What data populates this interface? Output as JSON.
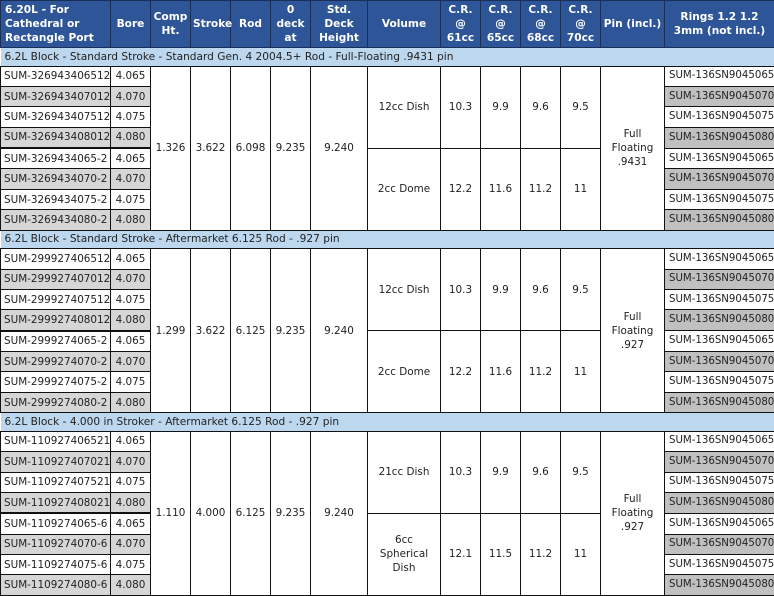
{
  "header": {
    "part": "6.20L - For Cathedral or Rectangle Port",
    "bore": "Bore",
    "comp_ht": "Comp Ht.",
    "stroke": "Stroke",
    "rod": "Rod",
    "deck0": "0 deck at",
    "std_deck": "Std. Deck Height",
    "volume": "Volume",
    "cr61": "C.R. @ 61cc",
    "cr65": "C.R. @ 65cc",
    "cr68": "C.R. @ 68cc",
    "cr70": "C.R. @ 70cc",
    "pin": "Pin (incl.)",
    "rings": "Rings 1.2 1.2 3mm (not incl.)"
  },
  "sections": [
    {
      "title": "6.2L Block - Standard Stroke - Standard Gen. 4  2004.5+ Rod - Full-Floating .9431 pin",
      "comp_ht": "1.326",
      "stroke": "3.622",
      "rod": "6.098",
      "deck0": "9.235",
      "std_deck": "9.240",
      "pin": "Full Floating .9431",
      "groups": [
        {
          "volume": "12cc Dish",
          "cr61": "10.3",
          "cr65": "9.9",
          "cr68": "9.6",
          "cr70": "9.5",
          "rows": [
            {
              "part": "SUM-326943406512",
              "bore": "4.065",
              "ring": "SUM-136SN9045065"
            },
            {
              "part": "SUM-326943407012",
              "bore": "4.070",
              "ring": "SUM-136SN9045070"
            },
            {
              "part": "SUM-326943407512",
              "bore": "4.075",
              "ring": "SUM-136SN9045075"
            },
            {
              "part": "SUM-326943408012",
              "bore": "4.080",
              "ring": "SUM-136SN9045080"
            }
          ]
        },
        {
          "volume": "2cc Dome",
          "cr61": "12.2",
          "cr65": "11.6",
          "cr68": "11.2",
          "cr70": "11",
          "rows": [
            {
              "part": "SUM-3269434065-2",
              "bore": "4.065",
              "ring": "SUM-136SN9045065"
            },
            {
              "part": "SUM-3269434070-2",
              "bore": "4.070",
              "ring": "SUM-136SN9045070"
            },
            {
              "part": "SUM-3269434075-2",
              "bore": "4.075",
              "ring": "SUM-136SN9045075"
            },
            {
              "part": "SUM-3269434080-2",
              "bore": "4.080",
              "ring": "SUM-136SN9045080"
            }
          ]
        }
      ]
    },
    {
      "title": "6.2L Block - Standard Stroke - Aftermarket 6.125 Rod - .927 pin",
      "comp_ht": "1.299",
      "stroke": "3.622",
      "rod": "6.125",
      "deck0": "9.235",
      "std_deck": "9.240",
      "pin": "Full Floating .927",
      "groups": [
        {
          "volume": "12cc Dish",
          "cr61": "10.3",
          "cr65": "9.9",
          "cr68": "9.6",
          "cr70": "9.5",
          "rows": [
            {
              "part": "SUM-299927406512",
              "bore": "4.065",
              "ring": "SUM-136SN9045065"
            },
            {
              "part": "SUM-299927407012",
              "bore": "4.070",
              "ring": "SUM-136SN9045070"
            },
            {
              "part": "SUM-299927407512",
              "bore": "4.075",
              "ring": "SUM-136SN9045075"
            },
            {
              "part": "SUM-299927408012",
              "bore": "4.080",
              "ring": "SUM-136SN9045080"
            }
          ]
        },
        {
          "volume": "2cc Dome",
          "cr61": "12.2",
          "cr65": "11.6",
          "cr68": "11.2",
          "cr70": "11",
          "rows": [
            {
              "part": "SUM-2999274065-2",
              "bore": "4.065",
              "ring": "SUM-136SN9045065"
            },
            {
              "part": "SUM-2999274070-2",
              "bore": "4.070",
              "ring": "SUM-136SN9045070"
            },
            {
              "part": "SUM-2999274075-2",
              "bore": "4.075",
              "ring": "SUM-136SN9045075"
            },
            {
              "part": "SUM-2999274080-2",
              "bore": "4.080",
              "ring": "SUM-136SN9045080"
            }
          ]
        }
      ]
    },
    {
      "title": "6.2L Block - 4.000 in Stroker - Aftermarket 6.125 Rod - .927 pin",
      "comp_ht": "1.110",
      "stroke": "4.000",
      "rod": "6.125",
      "deck0": "9.235",
      "std_deck": "9.240",
      "pin": "Full Floating .927",
      "groups": [
        {
          "volume": "21cc Dish",
          "cr61": "10.3",
          "cr65": "9.9",
          "cr68": "9.6",
          "cr70": "9.5",
          "rows": [
            {
              "part": "SUM-110927406521",
              "bore": "4.065",
              "ring": "SUM-136SN9045065"
            },
            {
              "part": "SUM-110927407021",
              "bore": "4.070",
              "ring": "SUM-136SN9045070"
            },
            {
              "part": "SUM-110927407521",
              "bore": "4.075",
              "ring": "SUM-136SN9045075"
            },
            {
              "part": "SUM-110927408021",
              "bore": "4.080",
              "ring": "SUM-136SN9045080"
            }
          ]
        },
        {
          "volume": "6cc Spherical Dish",
          "cr61": "12.1",
          "cr65": "11.5",
          "cr68": "11.2",
          "cr70": "11",
          "rows": [
            {
              "part": "SUM-1109274065-6",
              "bore": "4.065",
              "ring": "SUM-136SN9045065"
            },
            {
              "part": "SUM-1109274070-6",
              "bore": "4.070",
              "ring": "SUM-136SN9045070"
            },
            {
              "part": "SUM-1109274075-6",
              "bore": "4.075",
              "ring": "SUM-136SN9045075"
            },
            {
              "part": "SUM-1109274080-6",
              "bore": "4.080",
              "ring": "SUM-136SN9045080"
            }
          ]
        }
      ]
    }
  ]
}
